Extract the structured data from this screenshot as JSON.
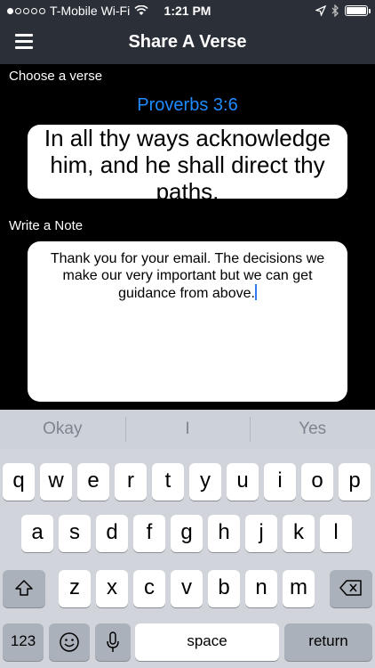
{
  "status_bar": {
    "carrier": "T-Mobile Wi-Fi",
    "time": "1:21 PM",
    "icons": [
      "signal-dots-icon",
      "wifi-icon",
      "location-arrow-icon",
      "bluetooth-icon",
      "battery-icon"
    ]
  },
  "nav": {
    "title": "Share A Verse",
    "menu_icon": "hamburger-menu-icon"
  },
  "verse_section": {
    "label": "Choose a verse",
    "reference": "Proverbs 3:6",
    "text": "In all thy ways acknowledge him, and he shall direct thy paths."
  },
  "note_section": {
    "label": "Write a Note",
    "value": "Thank you for your email. The decisions we make our very important but we can get guidance from above."
  },
  "keyboard": {
    "suggestions": [
      "Okay",
      "I",
      "Yes"
    ],
    "row1": [
      "q",
      "w",
      "e",
      "r",
      "t",
      "y",
      "u",
      "i",
      "o",
      "p"
    ],
    "row2": [
      "a",
      "s",
      "d",
      "f",
      "g",
      "h",
      "j",
      "k",
      "l"
    ],
    "row3": [
      "z",
      "x",
      "c",
      "v",
      "b",
      "n",
      "m"
    ],
    "numbers_key": "123",
    "space_key": "space",
    "return_key": "return",
    "shift_icon": "shift-icon",
    "delete_icon": "backspace-icon",
    "emoji_icon": "emoji-icon",
    "mic_icon": "microphone-icon"
  },
  "colors": {
    "nav_bg": "#2b2f38",
    "accent": "#1f8bff",
    "keyboard_bg": "#d1d5db"
  }
}
